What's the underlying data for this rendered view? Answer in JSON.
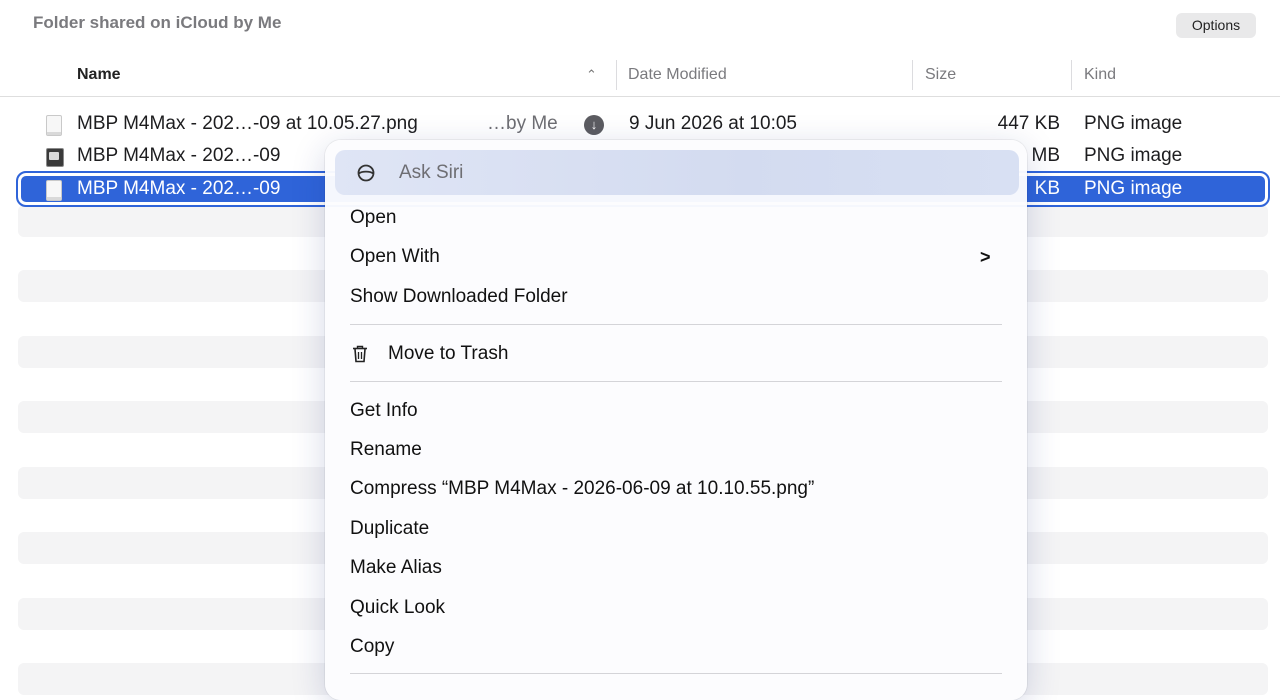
{
  "header": {
    "section_title": "Folder shared on iCloud by Me",
    "options_label": "Options"
  },
  "columns": {
    "name": "Name",
    "date": "Date Modified",
    "size": "Size",
    "kind": "Kind",
    "sort_indicator": "^"
  },
  "rows": [
    {
      "name": "MBP M4Max -  202…-09 at 10.05.27.png",
      "shared": "…by Me",
      "date": "9 Jun 2026 at 10:05",
      "size": "447 KB",
      "kind": "PNG image",
      "icon": "document-icon",
      "download": "download-icon"
    },
    {
      "name": "MBP M4Max -  202…-09",
      "size": "MB",
      "kind": "PNG image",
      "icon": "image-thumbnail-icon"
    },
    {
      "name": "MBP M4Max -  202…-09",
      "size": "KB",
      "kind": "PNG image",
      "icon": "document-icon",
      "selected": true
    }
  ],
  "context_menu": {
    "ask_siri": "Ask Siri",
    "open": "Open",
    "open_with": "Open With",
    "open_with_chevron": ">",
    "show_downloaded_folder": "Show Downloaded Folder",
    "move_to_trash": "Move to Trash",
    "get_info": "Get Info",
    "rename": "Rename",
    "compress": "Compress “MBP M4Max -  2026-06-09 at 10.10.55.png”",
    "duplicate": "Duplicate",
    "make_alias": "Make Alias",
    "quick_look": "Quick Look",
    "copy": "Copy"
  },
  "icons": {
    "download_glyph": "↓"
  },
  "colors": {
    "selection": "#2f64d9",
    "stripe": "#f4f4f5"
  }
}
